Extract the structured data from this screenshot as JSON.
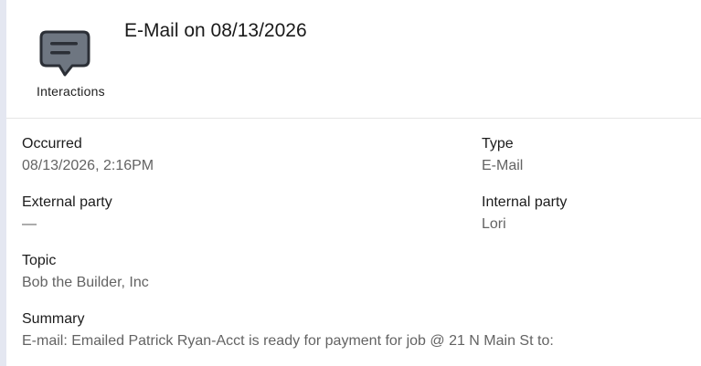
{
  "header": {
    "icon_label": "Interactions",
    "title": "E-Mail on 08/13/2026"
  },
  "fields": {
    "occurred": {
      "label": "Occurred",
      "value": "08/13/2026, 2:16PM"
    },
    "type": {
      "label": "Type",
      "value": "E-Mail"
    },
    "external_party": {
      "label": "External party",
      "value": "—"
    },
    "internal_party": {
      "label": "Internal party",
      "value": "Lori"
    },
    "topic": {
      "label": "Topic",
      "value": "Bob the Builder, Inc"
    },
    "summary": {
      "label": "Summary",
      "value": "E-mail: Emailed Patrick Ryan-Acct is ready for payment for job @ 21 N Main St to:"
    }
  },
  "colors": {
    "icon_fill": "#6e7681",
    "icon_stroke": "#2b2f36",
    "label_text": "#1c1c1c",
    "value_text": "#636363",
    "rail": "#e4e7f1"
  },
  "icons": {
    "interactions": "speech-bubble-icon"
  }
}
